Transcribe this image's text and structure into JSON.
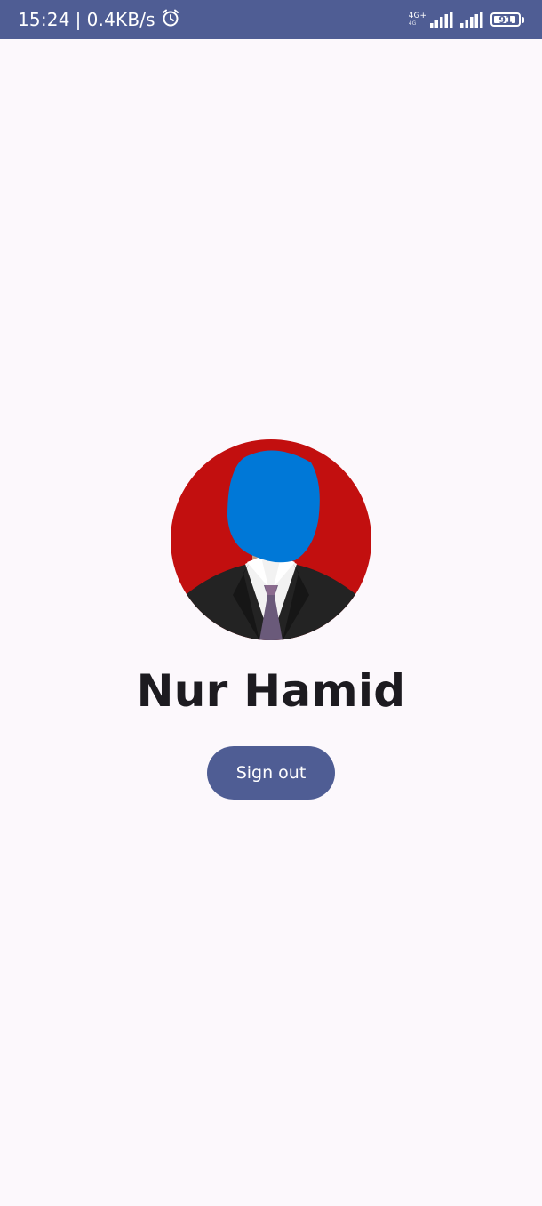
{
  "status_bar": {
    "time": "15:24",
    "separator": "|",
    "network_speed": "0.4KB/s",
    "alarm_icon": "alarm-clock-icon",
    "network_type": "4G+",
    "network_subtype": "4G",
    "battery_level": "91"
  },
  "profile": {
    "avatar_icon": "profile-photo",
    "name": "Nur Hamid"
  },
  "actions": {
    "sign_out_label": "Sign out"
  },
  "colors": {
    "primary": "#4f5d94",
    "background": "#fcf8fc",
    "text": "#1d1b20",
    "avatar_bg": "#c20f0f",
    "face_mask": "#0078d7"
  }
}
